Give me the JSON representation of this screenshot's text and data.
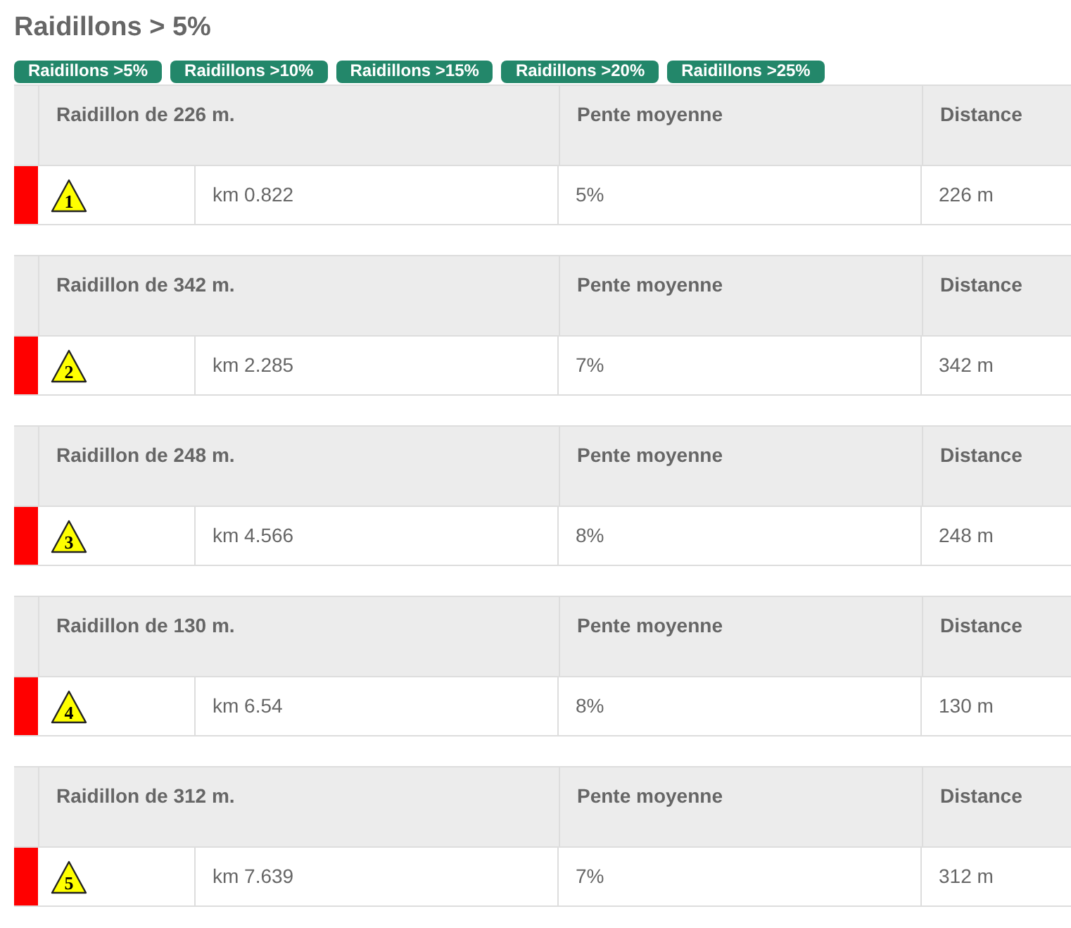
{
  "title": "Raidillons > 5%",
  "filters": [
    {
      "label": "Raidillons >5%"
    },
    {
      "label": "Raidillons >10%"
    },
    {
      "label": "Raidillons >15%"
    },
    {
      "label": "Raidillons >20%"
    },
    {
      "label": "Raidillons >25%"
    }
  ],
  "climbs": [
    {
      "heading": "Raidillon de 226 m.",
      "slope_heading": "Pente moyenne",
      "distance_heading": "Distance",
      "number": "1",
      "position": "km 0.822",
      "slope": "5%",
      "distance": "226 m"
    },
    {
      "heading": "Raidillon de 342 m.",
      "slope_heading": "Pente moyenne",
      "distance_heading": "Distance",
      "number": "2",
      "position": "km 2.285",
      "slope": "7%",
      "distance": "342 m"
    },
    {
      "heading": "Raidillon de 248 m.",
      "slope_heading": "Pente moyenne",
      "distance_heading": "Distance",
      "number": "3",
      "position": "km 4.566",
      "slope": "8%",
      "distance": "248 m"
    },
    {
      "heading": "Raidillon de 130 m.",
      "slope_heading": "Pente moyenne",
      "distance_heading": "Distance",
      "number": "4",
      "position": "km 6.54",
      "slope": "8%",
      "distance": "130 m"
    },
    {
      "heading": "Raidillon de 312 m.",
      "slope_heading": "Pente moyenne",
      "distance_heading": "Distance",
      "number": "5",
      "position": "km 7.639",
      "slope": "7%",
      "distance": "312 m"
    }
  ]
}
